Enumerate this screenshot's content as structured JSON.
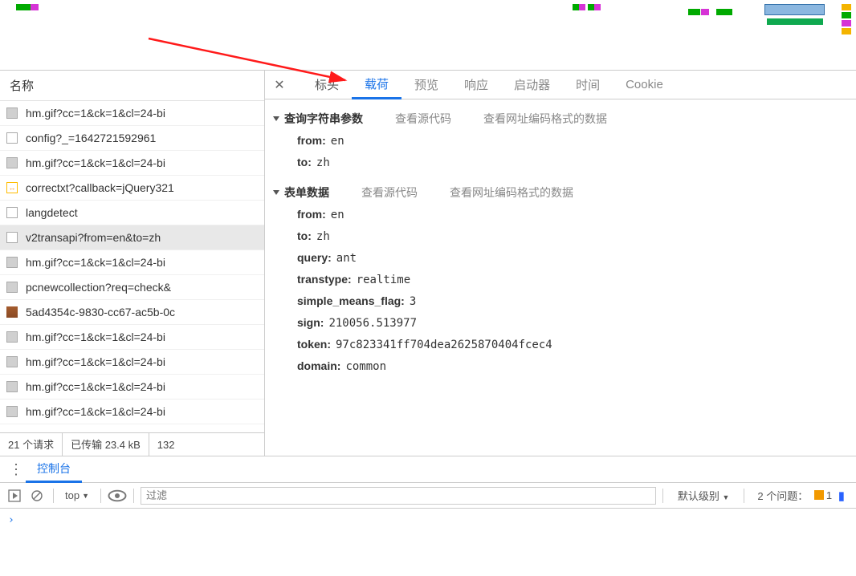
{
  "sidebar": {
    "header": "名称",
    "requests": [
      {
        "icon": "img",
        "name": "hm.gif?cc=1&ck=1&cl=24-bi"
      },
      {
        "icon": "doc",
        "name": "config?_=1642721592961"
      },
      {
        "icon": "img",
        "name": "hm.gif?cc=1&ck=1&cl=24-bi"
      },
      {
        "icon": "js",
        "js": "↔",
        "name": "correctxt?callback=jQuery321"
      },
      {
        "icon": "doc",
        "name": "langdetect"
      },
      {
        "icon": "doc",
        "name": "v2transapi?from=en&to=zh",
        "selected": true
      },
      {
        "icon": "img",
        "name": "hm.gif?cc=1&ck=1&cl=24-bi"
      },
      {
        "icon": "img",
        "name": "pcnewcollection?req=check&"
      },
      {
        "icon": "img2",
        "name": "5ad4354c-9830-cc67-ac5b-0c"
      },
      {
        "icon": "img",
        "name": "hm.gif?cc=1&ck=1&cl=24-bi"
      },
      {
        "icon": "img",
        "name": "hm.gif?cc=1&ck=1&cl=24-bi"
      },
      {
        "icon": "img",
        "name": "hm.gif?cc=1&ck=1&cl=24-bi"
      },
      {
        "icon": "img",
        "name": "hm.gif?cc=1&ck=1&cl=24-bi"
      }
    ],
    "status": {
      "req": "21 个请求",
      "xfer": "已传输 23.4 kB",
      "res": "132"
    }
  },
  "tabs": [
    "标头",
    "载荷",
    "预览",
    "响应",
    "启动器",
    "时间",
    "Cookie"
  ],
  "active_tab": 1,
  "sections": [
    {
      "title": "查询字符串参数",
      "links": [
        "查看源代码",
        "查看网址编码格式的数据"
      ],
      "kv": [
        {
          "k": "from:",
          "v": "en"
        },
        {
          "k": "to:",
          "v": "zh"
        }
      ]
    },
    {
      "title": "表单数据",
      "links": [
        "查看源代码",
        "查看网址编码格式的数据"
      ],
      "kv": [
        {
          "k": "from:",
          "v": "en"
        },
        {
          "k": "to:",
          "v": "zh"
        },
        {
          "k": "query:",
          "v": "ant"
        },
        {
          "k": "transtype:",
          "v": "realtime"
        },
        {
          "k": "simple_means_flag:",
          "v": "3"
        },
        {
          "k": "sign:",
          "v": "210056.513977"
        },
        {
          "k": "token:",
          "v": "97c823341ff704dea2625870404fcec4"
        },
        {
          "k": "domain:",
          "v": "common"
        }
      ]
    }
  ],
  "drawer": {
    "tab": "控制台",
    "context": "top",
    "filter_placeholder": "过滤",
    "levels": "默认级别",
    "issues_label": "2 个问题：",
    "issue_count": "1"
  }
}
